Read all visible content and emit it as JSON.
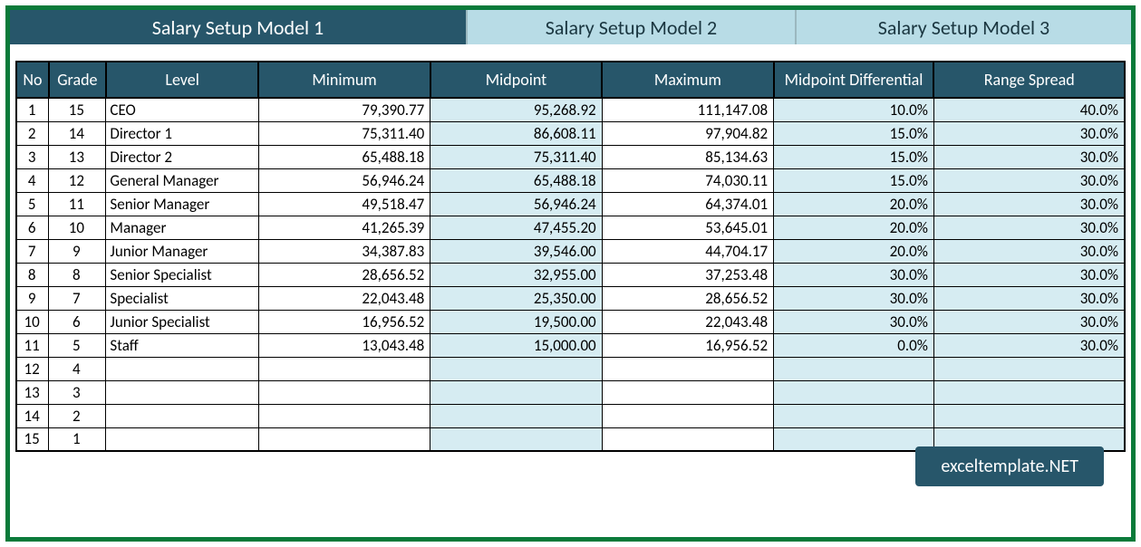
{
  "tabs": [
    {
      "label": "Salary Setup Model 1",
      "active": true
    },
    {
      "label": "Salary Setup Model 2",
      "active": false
    },
    {
      "label": "Salary Setup Model 3",
      "active": false
    }
  ],
  "headers": {
    "no": "No",
    "grade": "Grade",
    "level": "Level",
    "minimum": "Minimum",
    "midpoint": "Midpoint",
    "maximum": "Maximum",
    "midpoint_diff": "Midpoint Differential",
    "range_spread": "Range Spread"
  },
  "rows": [
    {
      "no": "1",
      "grade": "15",
      "level": "CEO",
      "min": "79,390.77",
      "mid": "95,268.92",
      "max": "111,147.08",
      "diff": "10.0%",
      "spread": "40.0%"
    },
    {
      "no": "2",
      "grade": "14",
      "level": "Director 1",
      "min": "75,311.40",
      "mid": "86,608.11",
      "max": "97,904.82",
      "diff": "15.0%",
      "spread": "30.0%"
    },
    {
      "no": "3",
      "grade": "13",
      "level": "Director 2",
      "min": "65,488.18",
      "mid": "75,311.40",
      "max": "85,134.63",
      "diff": "15.0%",
      "spread": "30.0%"
    },
    {
      "no": "4",
      "grade": "12",
      "level": "General Manager",
      "min": "56,946.24",
      "mid": "65,488.18",
      "max": "74,030.11",
      "diff": "15.0%",
      "spread": "30.0%"
    },
    {
      "no": "5",
      "grade": "11",
      "level": "Senior Manager",
      "min": "49,518.47",
      "mid": "56,946.24",
      "max": "64,374.01",
      "diff": "20.0%",
      "spread": "30.0%"
    },
    {
      "no": "6",
      "grade": "10",
      "level": "Manager",
      "min": "41,265.39",
      "mid": "47,455.20",
      "max": "53,645.01",
      "diff": "20.0%",
      "spread": "30.0%"
    },
    {
      "no": "7",
      "grade": "9",
      "level": "Junior Manager",
      "min": "34,387.83",
      "mid": "39,546.00",
      "max": "44,704.17",
      "diff": "20.0%",
      "spread": "30.0%"
    },
    {
      "no": "8",
      "grade": "8",
      "level": "Senior Specialist",
      "min": "28,656.52",
      "mid": "32,955.00",
      "max": "37,253.48",
      "diff": "30.0%",
      "spread": "30.0%"
    },
    {
      "no": "9",
      "grade": "7",
      "level": "Specialist",
      "min": "22,043.48",
      "mid": "25,350.00",
      "max": "28,656.52",
      "diff": "30.0%",
      "spread": "30.0%"
    },
    {
      "no": "10",
      "grade": "6",
      "level": "Junior Specialist",
      "min": "16,956.52",
      "mid": "19,500.00",
      "max": "22,043.48",
      "diff": "30.0%",
      "spread": "30.0%"
    },
    {
      "no": "11",
      "grade": "5",
      "level": "Staff",
      "min": "13,043.48",
      "mid": "15,000.00",
      "max": "16,956.52",
      "diff": "0.0%",
      "spread": "30.0%"
    },
    {
      "no": "12",
      "grade": "4",
      "level": "",
      "min": "",
      "mid": "",
      "max": "",
      "diff": "",
      "spread": ""
    },
    {
      "no": "13",
      "grade": "3",
      "level": "",
      "min": "",
      "mid": "",
      "max": "",
      "diff": "",
      "spread": ""
    },
    {
      "no": "14",
      "grade": "2",
      "level": "",
      "min": "",
      "mid": "",
      "max": "",
      "diff": "",
      "spread": ""
    },
    {
      "no": "15",
      "grade": "1",
      "level": "",
      "min": "",
      "mid": "",
      "max": "",
      "diff": "",
      "spread": ""
    }
  ],
  "watermark": "exceltemplate.NET"
}
